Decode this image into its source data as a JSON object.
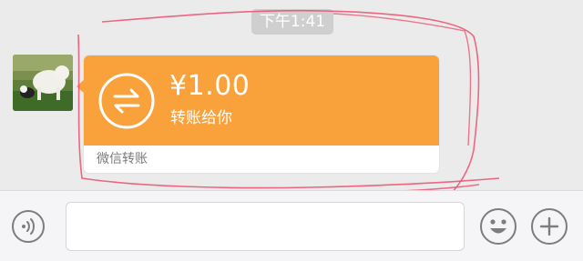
{
  "chat": {
    "timestamp": "下午1:41",
    "message": {
      "amount": "¥1.00",
      "description": "转账给你",
      "service": "微信转账"
    }
  },
  "colors": {
    "transfer_orange": "#f9a13b",
    "annotation_red": "#ec4f6d",
    "background": "#ebebeb"
  },
  "icons": {
    "transfer": "transfer-arrows-icon",
    "voice": "voice-icon",
    "emoji": "emoji-icon",
    "plus": "plus-icon"
  }
}
